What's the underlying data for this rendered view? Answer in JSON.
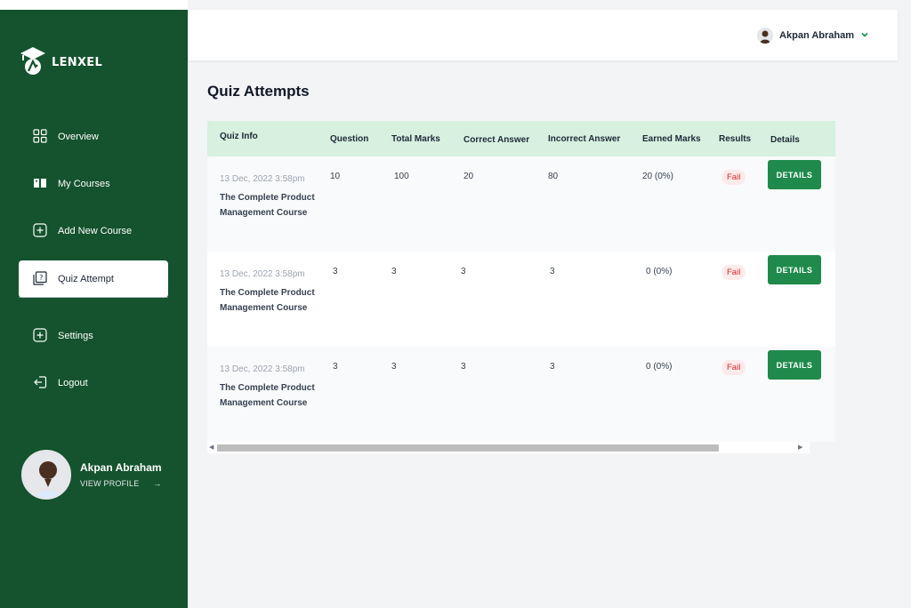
{
  "brand": {
    "name": "LENXEL",
    "icon": "graduation-cap-icon"
  },
  "sidebar": {
    "items": [
      {
        "label": "Overview",
        "icon": "grid-icon"
      },
      {
        "label": "My Courses",
        "icon": "book-icon"
      },
      {
        "label": "Add New Course",
        "icon": "plus-square-icon"
      },
      {
        "label": "Quiz Attempt",
        "icon": "quiz-icon",
        "active": true
      },
      {
        "label": "Settings",
        "icon": "plus-square-icon"
      },
      {
        "label": "Logout",
        "icon": "logout-icon"
      }
    ],
    "profile": {
      "name": "Akpan Abraham",
      "link": "VIEW PROFILE",
      "arrow": "→"
    }
  },
  "header": {
    "user_name": "Akpan Abraham",
    "chevron": "chevron-down-icon"
  },
  "page": {
    "title": "Quiz Attempts"
  },
  "table": {
    "columns": [
      "Quiz Info",
      "Question",
      "Total Marks",
      "Correct Answer",
      "Incorrect Answer",
      "Earned Marks",
      "Results",
      "Details"
    ],
    "rows": [
      {
        "date": "13 Dec, 2022 3:58pm",
        "course": "The Complete Product Management Course",
        "question": "10",
        "total": "100",
        "correct": "20",
        "incorrect": "80",
        "earned": "20 (0%)",
        "result": "Fail",
        "action": "DETAILS"
      },
      {
        "date": "13 Dec, 2022 3:58pm",
        "course": "The Complete Product Management Course",
        "question": "3",
        "total": "3",
        "correct": "3",
        "incorrect": "3",
        "earned": "0 (0%)",
        "result": "Fail",
        "action": "DETAILS"
      },
      {
        "date": "13 Dec, 2022 3:58pm",
        "course": "The Complete Product Management Course",
        "question": "3",
        "total": "3",
        "correct": "3",
        "incorrect": "3",
        "earned": "0 (0%)",
        "result": "Fail",
        "action": "DETAILS"
      }
    ]
  },
  "colors": {
    "sidebar": "#14532d",
    "accent": "#1f8a4c",
    "header_row": "#d7f0e0",
    "fail": "#dc2626"
  }
}
